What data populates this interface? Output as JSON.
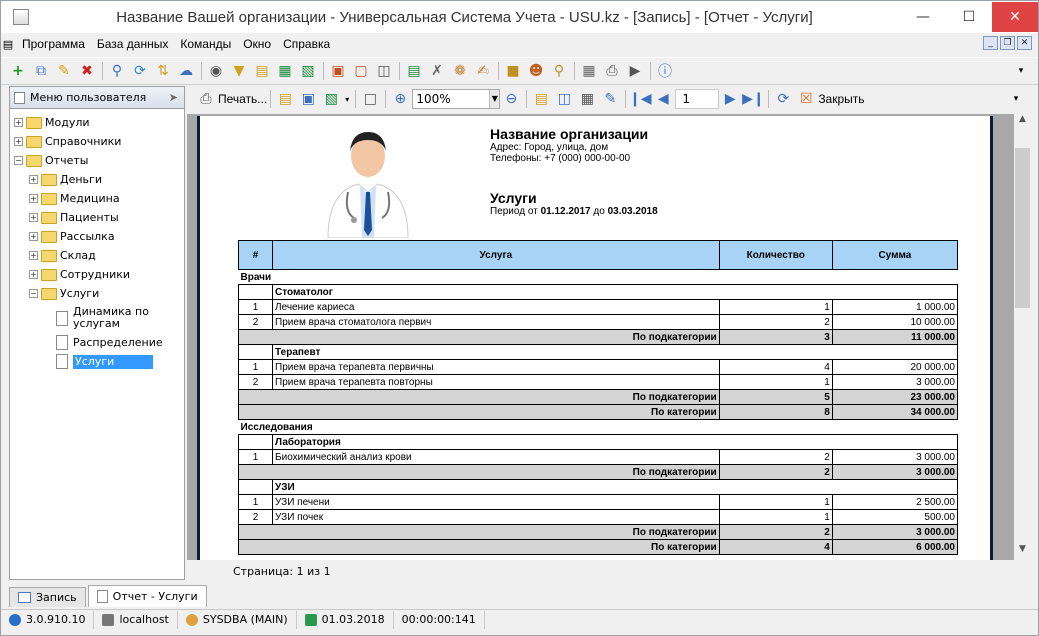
{
  "window": {
    "title": "Название Вашей организации - Универсальная Система Учета - USU.kz - [Запись] - [Отчет - Услуги]"
  },
  "menu": [
    "Программа",
    "База данных",
    "Команды",
    "Окно",
    "Справка"
  ],
  "left_panel": {
    "title": "Меню пользователя",
    "tree": [
      {
        "label": "Модули",
        "level": 0,
        "type": "folder",
        "expander": "+"
      },
      {
        "label": "Справочники",
        "level": 0,
        "type": "folder",
        "expander": "+"
      },
      {
        "label": "Отчеты",
        "level": 0,
        "type": "folder",
        "expander": "−"
      },
      {
        "label": "Деньги",
        "level": 1,
        "type": "folder",
        "expander": "+"
      },
      {
        "label": "Медицина",
        "level": 1,
        "type": "folder",
        "expander": "+"
      },
      {
        "label": "Пациенты",
        "level": 1,
        "type": "folder",
        "expander": "+"
      },
      {
        "label": "Рассылка",
        "level": 1,
        "type": "folder",
        "expander": "+"
      },
      {
        "label": "Склад",
        "level": 1,
        "type": "folder",
        "expander": "+"
      },
      {
        "label": "Сотрудники",
        "level": 1,
        "type": "folder",
        "expander": "+"
      },
      {
        "label": "Услуги",
        "level": 1,
        "type": "folder",
        "expander": "−"
      },
      {
        "label": "Динамика по услугам",
        "level": 2,
        "type": "doc"
      },
      {
        "label": "Распределение",
        "level": 2,
        "type": "doc"
      },
      {
        "label": "Услуги",
        "level": 2,
        "type": "doc",
        "selected": true
      }
    ]
  },
  "report_toolbar": {
    "print_label": "Печать...",
    "zoom": "100%",
    "page": "1",
    "close_label": "Закрыть"
  },
  "report": {
    "org_name": "Название организации",
    "address": "Адрес: Город, улица, дом",
    "phones": "Телефоны: +7 (000) 000-00-00",
    "title": "Услуги",
    "period_prefix": "Период от",
    "period_from": "01.12.2017",
    "period_mid": "до",
    "period_to": "03.03.2018",
    "columns": [
      "#",
      "Услуга",
      "Количество",
      "Сумма"
    ],
    "rows": [
      {
        "kind": "group",
        "text": "Врачи"
      },
      {
        "kind": "subgroup",
        "text": "Стоматолог"
      },
      {
        "kind": "item",
        "n": "1",
        "name": "Лечение кариеса",
        "qty": "1",
        "sum": "1 000.00"
      },
      {
        "kind": "item",
        "n": "2",
        "name": "Прием врача стоматолога первич",
        "qty": "2",
        "sum": "10 000.00"
      },
      {
        "kind": "total",
        "label": "По подкатегории",
        "qty": "3",
        "sum": "11 000.00"
      },
      {
        "kind": "subgroup",
        "text": "Терапевт"
      },
      {
        "kind": "item",
        "n": "1",
        "name": "Прием врача терапевта первичны",
        "qty": "4",
        "sum": "20 000.00"
      },
      {
        "kind": "item",
        "n": "2",
        "name": "Прием врача терапевта повторны",
        "qty": "1",
        "sum": "3 000.00"
      },
      {
        "kind": "total",
        "label": "По подкатегории",
        "qty": "5",
        "sum": "23 000.00"
      },
      {
        "kind": "total",
        "label": "По категории",
        "qty": "8",
        "sum": "34 000.00"
      },
      {
        "kind": "group",
        "text": "Исследования"
      },
      {
        "kind": "subgroup",
        "text": "Лаборатория"
      },
      {
        "kind": "item",
        "n": "1",
        "name": "Биохимический анализ крови",
        "qty": "2",
        "sum": "3 000.00"
      },
      {
        "kind": "total",
        "label": "По подкатегории",
        "qty": "2",
        "sum": "3 000.00"
      },
      {
        "kind": "subgroup",
        "text": "УЗИ"
      },
      {
        "kind": "item",
        "n": "1",
        "name": "УЗИ печени",
        "qty": "1",
        "sum": "2 500.00"
      },
      {
        "kind": "item",
        "n": "2",
        "name": "УЗИ почек",
        "qty": "1",
        "sum": "500.00"
      },
      {
        "kind": "total",
        "label": "По подкатегории",
        "qty": "2",
        "sum": "3 000.00"
      },
      {
        "kind": "total",
        "label": "По категории",
        "qty": "4",
        "sum": "6 000.00"
      }
    ]
  },
  "page_status": "Страница: 1 из 1",
  "tabs": [
    "Запись",
    "Отчет - Услуги"
  ],
  "status_bar": {
    "version": "3.0.910.10",
    "host": "localhost",
    "user": "SYSDBA (MAIN)",
    "date": "01.03.2018",
    "timer": "00:00:00:141"
  }
}
